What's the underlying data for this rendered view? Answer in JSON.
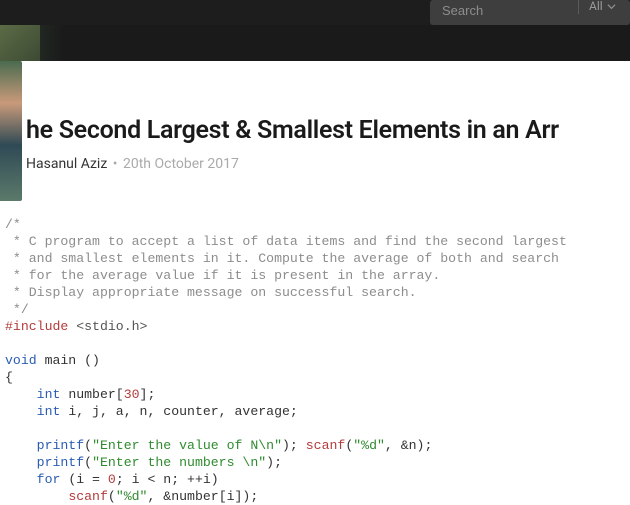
{
  "topbar": {
    "search_placeholder": "Search",
    "filter_label": "All"
  },
  "post": {
    "title": "he Second Largest & Smallest Elements in an Arr",
    "author": "Hasanul Aziz",
    "dot": "•",
    "date": "20th October 2017"
  },
  "code": {
    "comment_l1": "/*",
    "comment_l2": " * C program to accept a list of data items and find the second largest",
    "comment_l3": " * and smallest elements in it. Compute the average of both and search",
    "comment_l4": " * for the average value if it is present in the array.",
    "comment_l5": " * Display appropriate message on successful search.",
    "comment_l6": " */",
    "include_kw": "#include",
    "include_file": " <stdio.h>",
    "void_kw": "void",
    "main_sig": " main ()",
    "brace_open": "{",
    "int_kw": "int",
    "arr_decl_pre": " number[",
    "arr_size": "30",
    "arr_decl_post": "];",
    "vars_decl": " i, j, a, n, counter, average;",
    "printf_kw": "printf",
    "paren_open": "(",
    "str1": "\"Enter the value of N\\n\"",
    "after_str1": "); ",
    "scanf_kw": "scanf",
    "scanf_fmt": "\"%d\"",
    "scanf_after": ", &n);",
    "str2": "\"Enter the numbers \\n\"",
    "after_str2": ");",
    "for_kw": "for",
    "for_open": " (i = ",
    "zero": "0",
    "for_mid": "; i < n; ++i)",
    "scanf2_after": ", &number[i]);",
    "indent4": "    ",
    "indent8_guide": "        "
  }
}
